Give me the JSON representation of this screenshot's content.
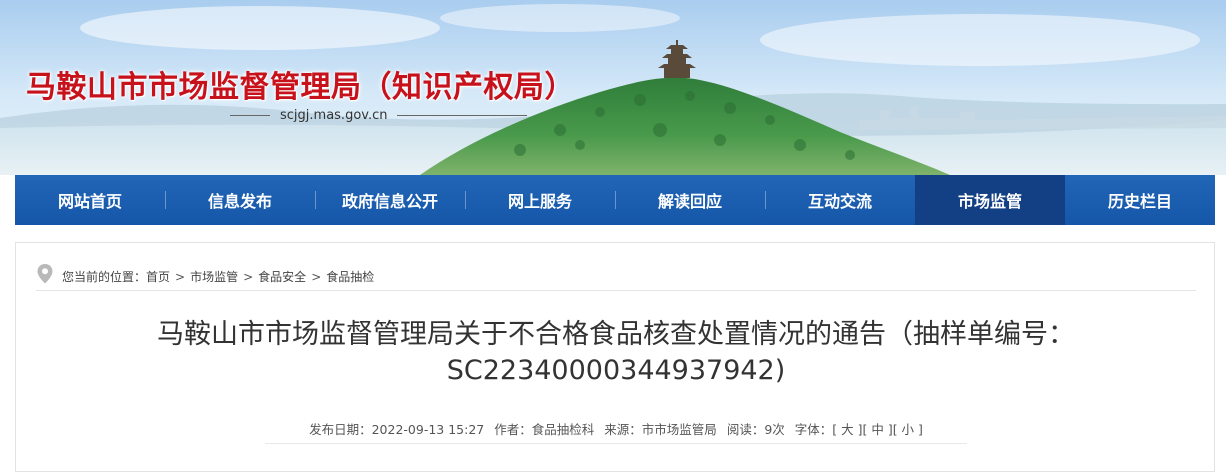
{
  "header": {
    "site_title": "马鞍山市市场监督管理局（知识产权局）",
    "site_domain": "scjgj.mas.gov.cn"
  },
  "nav": {
    "items": [
      {
        "label": "网站首页"
      },
      {
        "label": "信息发布"
      },
      {
        "label": "政府信息公开"
      },
      {
        "label": "网上服务"
      },
      {
        "label": "解读回应"
      },
      {
        "label": "互动交流"
      },
      {
        "label": "市场监管"
      },
      {
        "label": "历史栏目"
      }
    ],
    "active_index": 6
  },
  "breadcrumb": {
    "prefix": "您当前的位置：",
    "items": [
      "首页",
      "市场监管",
      "食品安全",
      "食品抽检"
    ],
    "separator": ">"
  },
  "article": {
    "title_line1": "马鞍山市市场监督管理局关于不合格食品核查处置情况的通告（抽样单编号：",
    "title_line2": "SC22340000344937942)",
    "meta": {
      "date_label": "发布日期：",
      "date": "2022-09-13 15:27",
      "author_label": "作者：",
      "author": "食品抽检科",
      "source_label": "来源：",
      "source": "市市场监管局",
      "views_label": "阅读：",
      "views": "9次",
      "font_label": "字体：",
      "font_large": "[ 大 ]",
      "font_medium": "[ 中 ]",
      "font_small": "[ 小 ]"
    }
  },
  "colors": {
    "title_red": "#c8121b",
    "nav_blue": "#1a5eb0",
    "nav_active": "#133f84"
  },
  "icons": {
    "breadcrumb_icon": "location-pin-icon"
  }
}
